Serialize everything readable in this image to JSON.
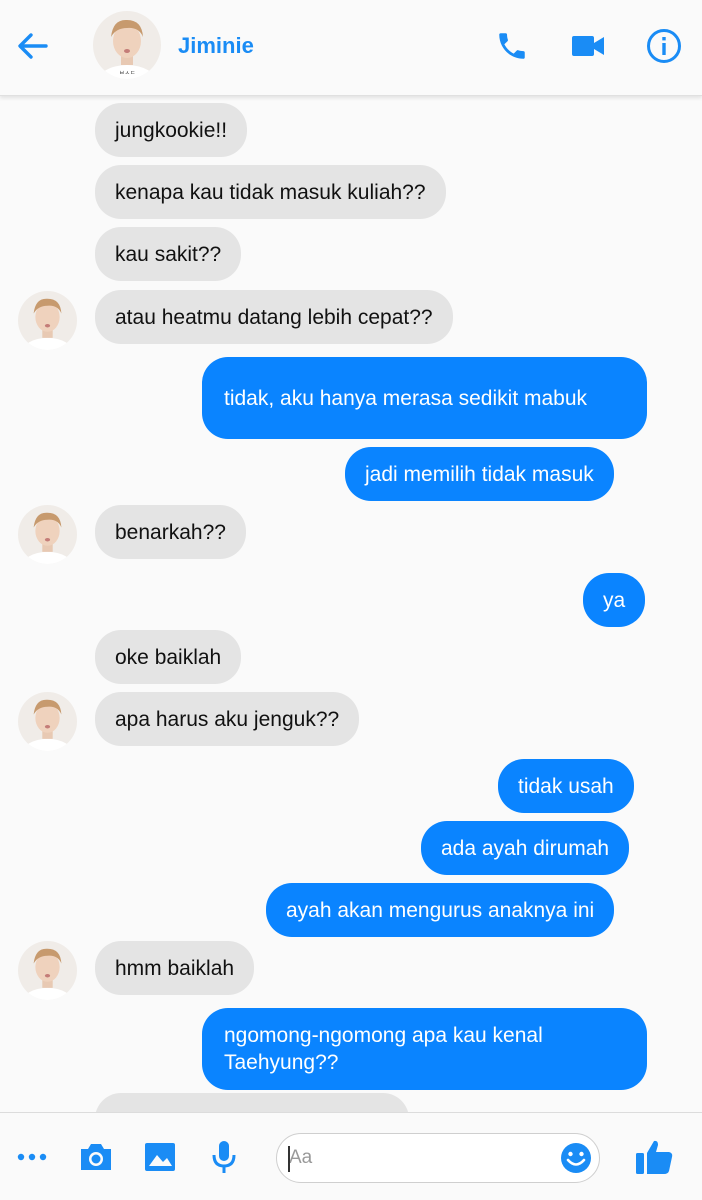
{
  "header": {
    "contact_name": "Jiminie",
    "icons": [
      "back-arrow-icon",
      "phone-icon",
      "video-camera-icon",
      "info-icon"
    ]
  },
  "messages": [
    {
      "side": "in",
      "text": "jungkookie!!",
      "avatar": false
    },
    {
      "side": "in",
      "text": "kenapa kau tidak masuk kuliah??",
      "avatar": false
    },
    {
      "side": "in",
      "text": "kau sakit??",
      "avatar": false
    },
    {
      "side": "in",
      "text": "atau heatmu datang lebih cepat??",
      "avatar": true
    },
    {
      "side": "out",
      "text": "tidak, aku hanya merasa sedikit mabuk"
    },
    {
      "side": "out",
      "text": "jadi memilih tidak masuk"
    },
    {
      "side": "in",
      "text": "benarkah??",
      "avatar": true
    },
    {
      "side": "out",
      "text": "ya"
    },
    {
      "side": "in",
      "text": "oke baiklah",
      "avatar": false
    },
    {
      "side": "in",
      "text": "apa harus aku jenguk??",
      "avatar": true
    },
    {
      "side": "out",
      "text": "tidak usah"
    },
    {
      "side": "out",
      "text": "ada ayah dirumah"
    },
    {
      "side": "out",
      "text": "ayah akan mengurus anaknya ini"
    },
    {
      "side": "in",
      "text": "hmm baiklah",
      "avatar": true
    },
    {
      "side": "out",
      "text": "ngomong-ngomong apa kau kenal Taehyung??"
    }
  ],
  "composer": {
    "placeholder": "Aa",
    "icons": [
      "more-icon",
      "camera-icon",
      "gallery-icon",
      "microphone-icon",
      "emoji-icon",
      "thumbs-up-icon"
    ]
  },
  "colors": {
    "accent": "#1a8cf5",
    "outgoing_bubble": "#0a84ff",
    "incoming_bubble": "#e4e4e4",
    "background": "#fafafa"
  }
}
